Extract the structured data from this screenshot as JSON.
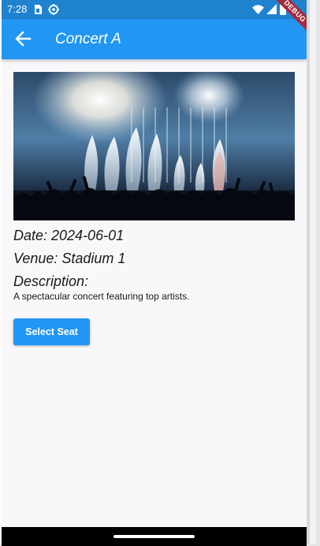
{
  "status_bar": {
    "time": "7:28",
    "icons": [
      "sim-card-icon",
      "gear-icon",
      "wifi-icon",
      "signal-icon",
      "battery-icon"
    ]
  },
  "app_bar": {
    "back_icon": "arrow-back-icon",
    "title": "Concert A"
  },
  "debug_banner": "DEBUG",
  "event": {
    "image_alt": "concert-crowd-image",
    "date_line": "Date: 2024-06-01",
    "venue_line": "Venue: Stadium 1",
    "description_heading": "Description:",
    "description_text": "A spectacular concert featuring top artists."
  },
  "actions": {
    "select_seat_label": "Select Seat"
  },
  "colors": {
    "status_bar": "#1f82cf",
    "app_bar": "#2196f3",
    "button": "#2196f3",
    "background": "#f8f8fa",
    "debug_ribbon": "#a8283b"
  }
}
